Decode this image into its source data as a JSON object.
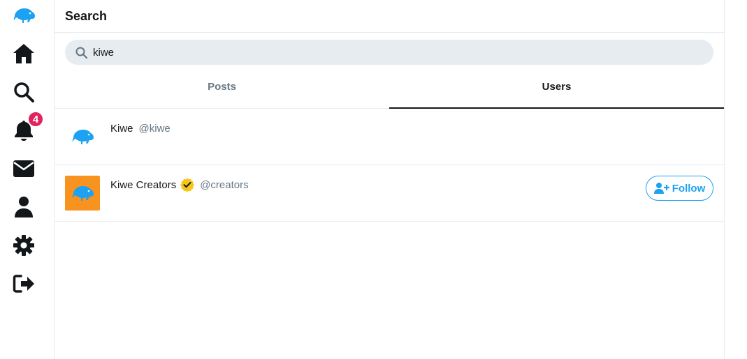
{
  "header": {
    "title": "Search"
  },
  "search": {
    "value": "kiwe",
    "placeholder": "Search"
  },
  "tabs": [
    {
      "label": "Posts",
      "active": false
    },
    {
      "label": "Users",
      "active": true
    }
  ],
  "notifications": {
    "count": "4"
  },
  "sidebar": {
    "items": [
      {
        "icon": "kiwi-logo-icon"
      },
      {
        "icon": "home-icon"
      },
      {
        "icon": "search-icon"
      },
      {
        "icon": "bell-icon"
      },
      {
        "icon": "envelope-icon"
      },
      {
        "icon": "user-icon"
      },
      {
        "icon": "gear-icon"
      },
      {
        "icon": "sign-out-icon"
      }
    ]
  },
  "results": [
    {
      "name": "Kiwe",
      "handle": "@kiwe",
      "verified": false,
      "avatar_bg": "#ffffff",
      "follow": false
    },
    {
      "name": "Kiwe Creators",
      "handle": "@creators",
      "verified": true,
      "avatar_bg": "#f7931e",
      "follow": true,
      "follow_label": "Follow"
    }
  ],
  "colors": {
    "accent": "#1da1f2",
    "badge": "#e0245e",
    "verified": "#f5c518",
    "icon": "#14171a"
  }
}
